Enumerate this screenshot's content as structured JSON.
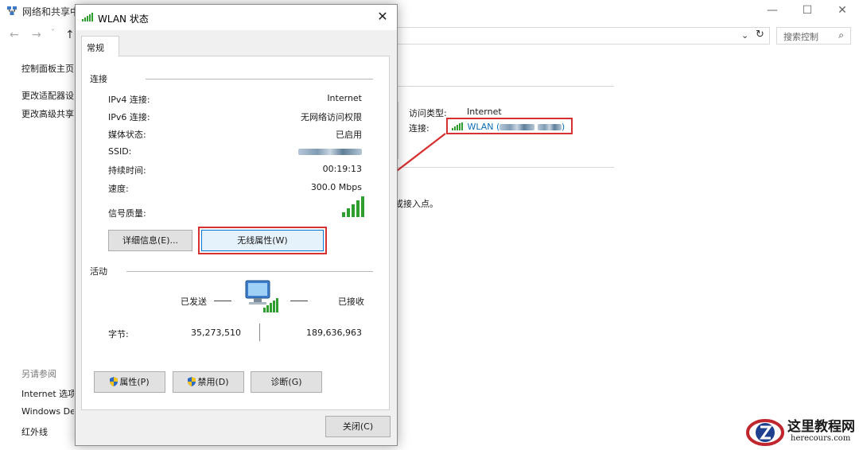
{
  "background_window": {
    "title": "网络和共享中心",
    "window_controls": [
      "—",
      "☐",
      "✕"
    ],
    "nav": {
      "back": "←",
      "forward": "→",
      "dropdown": "˅",
      "up": "↑"
    },
    "address_dropdown": "⌄",
    "refresh": "↻",
    "search_placeholder": "搜索控制",
    "sidebar": {
      "home": "控制面板主页",
      "adapter_settings": "更改适配器设",
      "advanced_sharing": "更改高级共享",
      "see_also_heading": "另请参阅",
      "internet_options": "Internet 选项",
      "windows_defender": "Windows De",
      "infrared": "红外线"
    },
    "connection_info": {
      "access_type_label": "访问类型:",
      "access_type_value": "Internet",
      "connection_label": "连接:",
      "connection_value": "WLAN (",
      "connection_value_end": ")"
    },
    "fragment_text": "或接入点。",
    "fragment_dot": "。"
  },
  "dialog": {
    "title": "WLAN 状态",
    "close_glyph": "✕",
    "tab": "常规",
    "connection_group": {
      "label": "连接",
      "rows": [
        {
          "label": "IPv4 连接:",
          "value": "Internet"
        },
        {
          "label": "IPv6 连接:",
          "value": "无网络访问权限"
        },
        {
          "label": "媒体状态:",
          "value": "已启用"
        },
        {
          "label": "SSID:",
          "value": ""
        },
        {
          "label": "持续时间:",
          "value": "00:19:13"
        },
        {
          "label": "速度:",
          "value": "300.0 Mbps"
        }
      ],
      "signal_label": "信号质量:",
      "signal_bars": 5
    },
    "buttons": {
      "details": "详细信息(E)...",
      "wireless_properties": "无线属性(W)",
      "properties": "属性(P)",
      "disable": "禁用(D)",
      "diagnose": "诊断(G)",
      "close": "关闭(C)"
    },
    "activity_group": {
      "label": "活动",
      "sent_label": "已发送",
      "received_label": "已接收",
      "bytes_label": "字节:",
      "bytes_sent": "35,273,510",
      "bytes_received": "189,636,963"
    }
  },
  "watermark": {
    "name": "这里教程网",
    "domain": "herecours.com"
  },
  "colors": {
    "highlight_red": "#d63030",
    "link_blue": "#0d6fb8",
    "focus_blue": "#0078d7",
    "signal_green": "#2e9e2e"
  }
}
